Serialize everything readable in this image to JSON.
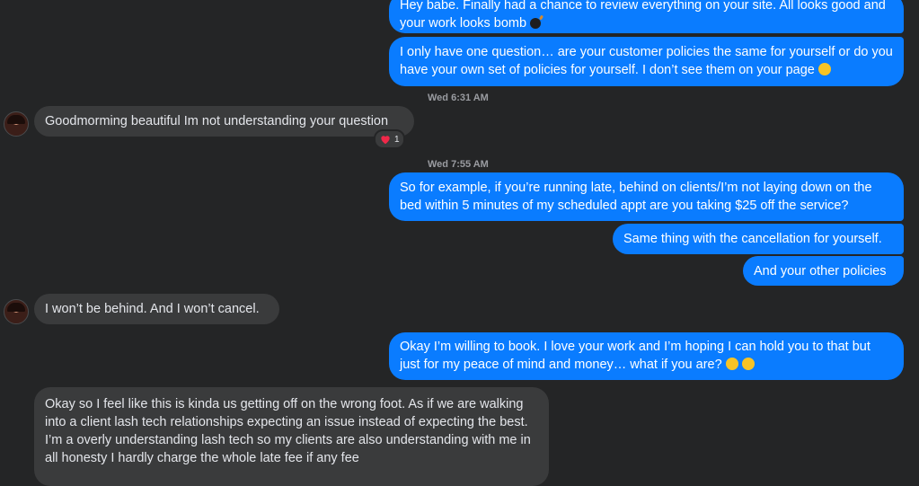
{
  "conversation": {
    "messages": [
      {
        "id": "m1",
        "side": "out",
        "text": "Hey babe. Finally had a chance to review everything on your site. All looks good and your work looks bomb",
        "emoji": "bomb-emoji"
      },
      {
        "id": "m2",
        "side": "out",
        "text": "I only have one question… are your customer policies the same for yourself or do you have your own set of policies for yourself. I don’t see them on your page",
        "emoji": "smile-emoji"
      },
      {
        "id": "ts1",
        "type": "timestamp",
        "text": "Wed 6:31 AM"
      },
      {
        "id": "m3",
        "side": "in",
        "text": "Goodmorming beautiful Im not understanding your question",
        "reaction": {
          "icon": "heart-icon",
          "count": "1"
        }
      },
      {
        "id": "ts2",
        "type": "timestamp",
        "text": "Wed 7:55 AM"
      },
      {
        "id": "m4",
        "side": "out",
        "text": "So for example, if you’re running late, behind on clients/I’m not laying down on the bed within 5 minutes of my scheduled appt are you taking $25 off the service?"
      },
      {
        "id": "m5",
        "side": "out",
        "text": "Same thing with the cancellation for yourself."
      },
      {
        "id": "m6",
        "side": "out",
        "text": "And your other policies"
      },
      {
        "id": "m7",
        "side": "in",
        "text": "I won’t be behind. And I won’t cancel."
      },
      {
        "id": "m8",
        "side": "out",
        "text": "Okay I’m willing to book. I love your work and I’m hoping I can hold you to that but just for my peace of mind and money… what if you are?",
        "emoji": "relieved-emoji hug-emoji"
      },
      {
        "id": "m9",
        "side": "in",
        "text": "Okay so I feel like this is kinda us getting off on the wrong foot. As if we are walking into a client lash tech relationships expecting an issue instead of expecting the best. I’m a overly understanding lash tech so my clients are also understanding with me in all honesty I hardly charge the whole late fee if any fee"
      }
    ]
  },
  "colors": {
    "outgoing": "#0a7cff",
    "incoming": "#3a3b3c",
    "background": "#242526"
  }
}
